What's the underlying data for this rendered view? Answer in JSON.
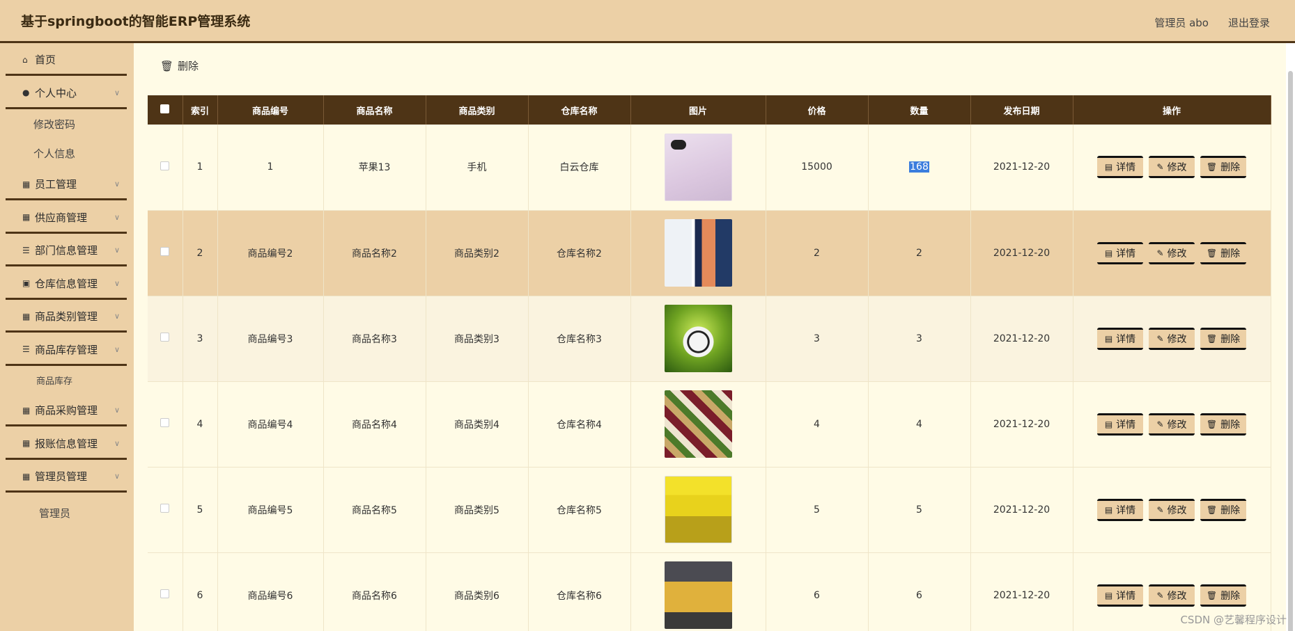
{
  "header": {
    "title": "基于springboot的智能ERP管理系统",
    "user": "管理员 abo",
    "logout": "退出登录"
  },
  "sidebar": {
    "home": "首页",
    "personal": "个人中心",
    "change_password": "修改密码",
    "personal_info": "个人信息",
    "employee": "员工管理",
    "supplier": "供应商管理",
    "department": "部门信息管理",
    "warehouse": "仓库信息管理",
    "category": "商品类别管理",
    "stock": "商品库存管理",
    "stock_sub": "商品库存",
    "purchase": "商品采购管理",
    "reimburse": "报账信息管理",
    "admin": "管理员管理",
    "admin_sub": "管理员"
  },
  "toolbar": {
    "delete": "删除"
  },
  "table": {
    "headers": [
      "索引",
      "商品编号",
      "商品名称",
      "商品类别",
      "仓库名称",
      "图片",
      "价格",
      "数量",
      "发布日期",
      "操作"
    ],
    "rows": [
      {
        "index": "1",
        "code": "1",
        "name": "苹果13",
        "category": "手机",
        "warehouse": "白云仓库",
        "price": "15000",
        "qty": "168",
        "date": "2021-12-20",
        "image": "iphone"
      },
      {
        "index": "2",
        "code": "商品编号2",
        "name": "商品名称2",
        "category": "商品类别2",
        "warehouse": "仓库名称2",
        "price": "2",
        "qty": "2",
        "date": "2021-12-20",
        "image": "huawei-phone"
      },
      {
        "index": "3",
        "code": "商品编号3",
        "name": "商品名称3",
        "category": "商品类别3",
        "warehouse": "仓库名称3",
        "price": "3",
        "qty": "3",
        "date": "2021-12-20",
        "image": "soccer-ball"
      },
      {
        "index": "4",
        "code": "商品编号4",
        "name": "商品名称4",
        "category": "商品类别4",
        "warehouse": "仓库名称4",
        "price": "4",
        "qty": "4",
        "date": "2021-12-20",
        "image": "food-box"
      },
      {
        "index": "5",
        "code": "商品编号5",
        "name": "商品名称5",
        "category": "商品类别5",
        "warehouse": "仓库名称5",
        "price": "5",
        "qty": "5",
        "date": "2021-12-20",
        "image": "book"
      },
      {
        "index": "6",
        "code": "商品编号6",
        "name": "商品名称6",
        "category": "商品类别6",
        "warehouse": "仓库名称6",
        "price": "6",
        "qty": "6",
        "date": "2021-12-20",
        "image": "woman-photo"
      }
    ],
    "actions": {
      "detail": "详情",
      "edit": "修改",
      "delete": "删除"
    }
  },
  "watermark": "CSDN @艺馨程序设计"
}
